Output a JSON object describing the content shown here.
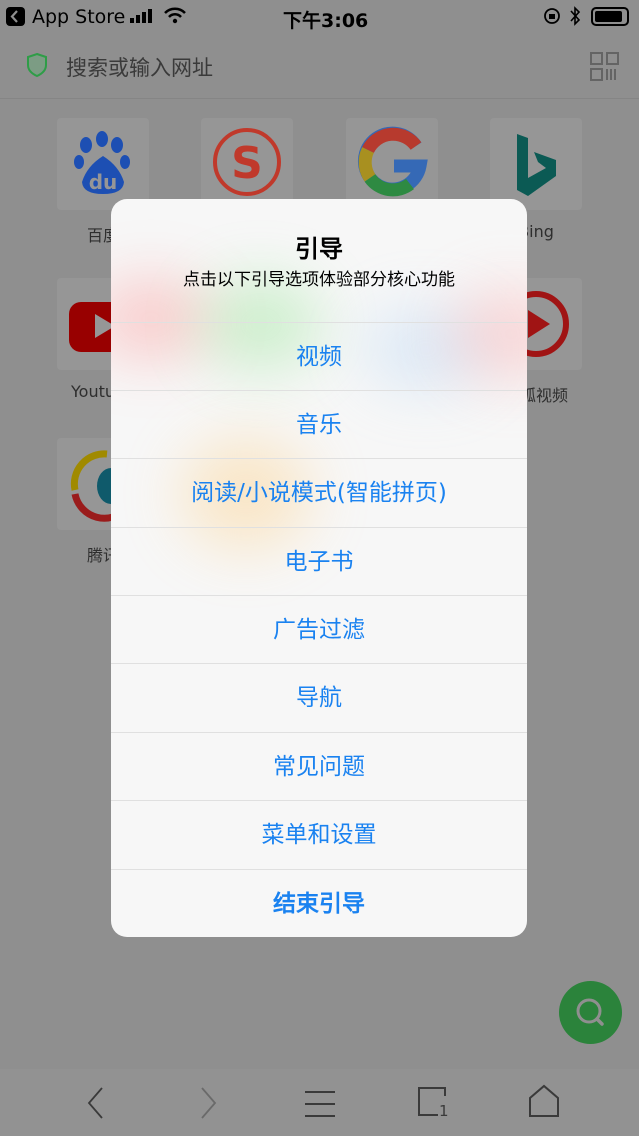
{
  "status_bar": {
    "back_app": "App Store",
    "time": "下午3:06",
    "icons": [
      "signal-icon",
      "wifi-icon",
      "orientation-lock-icon",
      "bluetooth-icon",
      "battery-icon"
    ]
  },
  "address_bar": {
    "placeholder": "搜索或输入网址",
    "icons": [
      "shield-icon",
      "qr-scan-icon"
    ]
  },
  "speed_dial": [
    {
      "label": "百度",
      "icon": "baidu-icon"
    },
    {
      "label": "",
      "icon": "sohu-icon"
    },
    {
      "label": "",
      "icon": "google-icon"
    },
    {
      "label": "Bing",
      "icon": "bing-icon"
    },
    {
      "label": "Youtube",
      "icon": "youtube-icon"
    },
    {
      "label": "搜狐视频",
      "icon": "sohu-video-icon"
    },
    {
      "label": "腾讯",
      "icon": "tencent-news-icon"
    }
  ],
  "dialog": {
    "title": "引导",
    "subtitle": "点击以下引导选项体验部分核心功能",
    "options": [
      "视频",
      "音乐",
      "阅读/小说模式(智能拼页)",
      "电子书",
      "广告过滤",
      "导航",
      "常见问题",
      "菜单和设置"
    ],
    "end_label": "结束引导",
    "accent": "#1a82f0"
  },
  "fab": {
    "icon": "search-icon",
    "color": "#2b833b"
  },
  "toolbar": {
    "tab_count": "1",
    "icons": [
      "back-icon",
      "forward-icon",
      "menu-icon",
      "tabs-icon",
      "home-icon"
    ]
  }
}
